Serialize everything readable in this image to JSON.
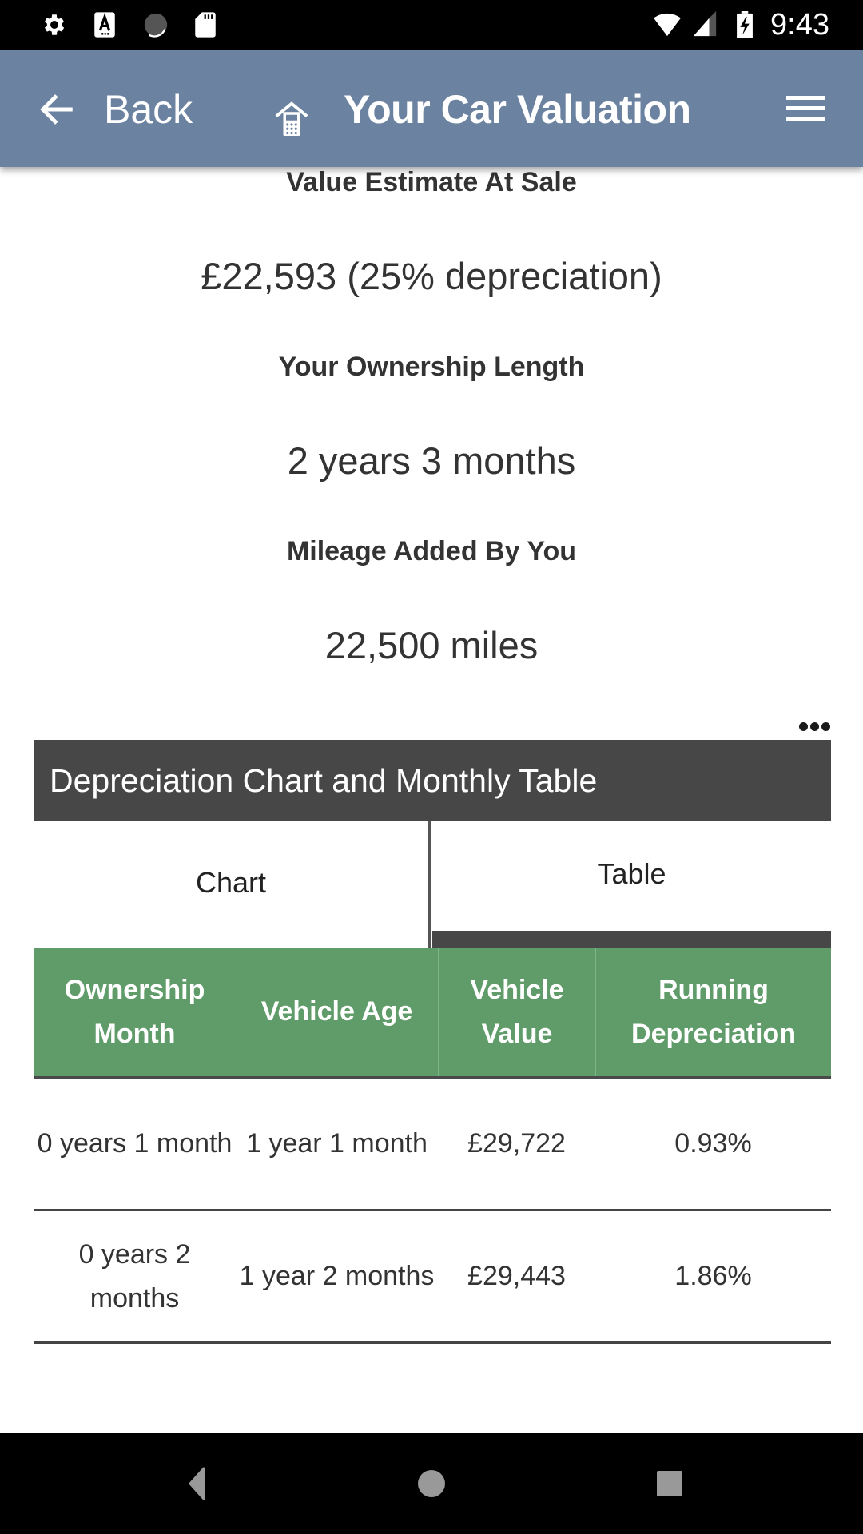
{
  "status_bar": {
    "time": "9:43",
    "left_icons": [
      "gear-icon",
      "accessibility-a-icon",
      "loading-circle-icon",
      "sd-card-icon"
    ],
    "right_icons": [
      "wifi-icon",
      "cell-signal-icon",
      "battery-charging-icon"
    ]
  },
  "app_bar": {
    "back_label": "Back",
    "title": "Your Car Valuation",
    "icons": [
      "back-arrow-icon",
      "home-calculator-icon",
      "hamburger-menu-icon"
    ],
    "color": "#6C82A1"
  },
  "summary": [
    {
      "label": "Value Estimate At Sale",
      "value": "£22,593 (25% depreciation)"
    },
    {
      "label": "Your Ownership Length",
      "value": "2 years 3 months"
    },
    {
      "label": "Mileage Added By You",
      "value": "22,500 miles"
    }
  ],
  "section": {
    "title": "Depreciation Chart and Monthly Table",
    "more_icon": "more-horizontal-icon",
    "tabs": [
      {
        "label": "Chart",
        "active": false
      },
      {
        "label": "Table",
        "active": true
      }
    ]
  },
  "table": {
    "header_color": "#5F9C69",
    "columns": [
      "Ownership Month",
      "Vehicle Age",
      "Vehicle Value",
      "Running Depreciation"
    ],
    "rows": [
      [
        "0 years 1 month",
        "1 year 1 month",
        "£29,722",
        "0.93%"
      ],
      [
        "0 years 2 months",
        "1 year 2 months",
        "£29,443",
        "1.86%"
      ]
    ]
  },
  "nav_bar": {
    "buttons": [
      "back-triangle-icon",
      "home-circle-icon",
      "recents-square-icon"
    ]
  }
}
